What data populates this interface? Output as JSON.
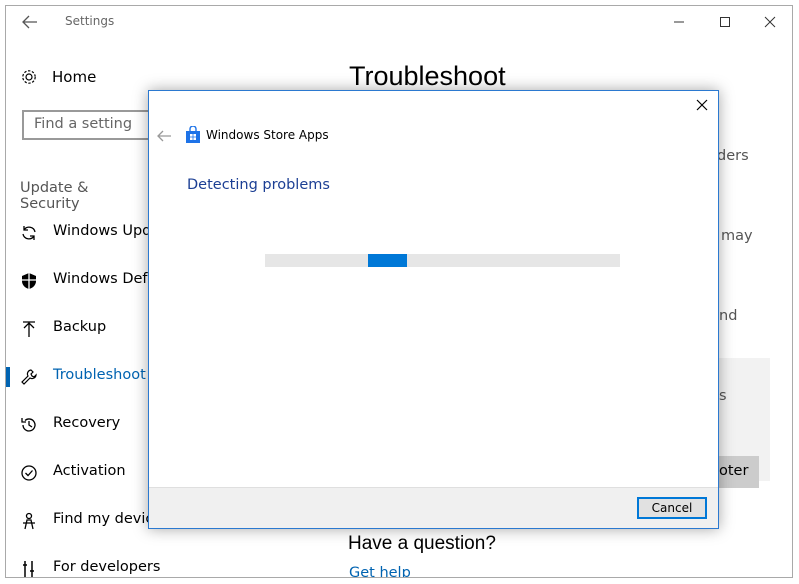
{
  "window": {
    "title": "Settings",
    "controls": [
      "minimize",
      "maximize",
      "close"
    ]
  },
  "sidebar": {
    "home_label": "Home",
    "search_placeholder": "Find a setting",
    "section": "Update & Security",
    "items": [
      {
        "label": "Windows Update",
        "icon": "sync-icon",
        "active": false
      },
      {
        "label": "Windows Defender",
        "icon": "shield-icon",
        "active": false
      },
      {
        "label": "Backup",
        "icon": "backup-arrow-icon",
        "active": false
      },
      {
        "label": "Troubleshoot",
        "icon": "wrench-icon",
        "active": true
      },
      {
        "label": "Recovery",
        "icon": "history-icon",
        "active": false
      },
      {
        "label": "Activation",
        "icon": "checkmark-circle-icon",
        "active": false
      },
      {
        "label": "Find my device",
        "icon": "person-locate-icon",
        "active": false
      },
      {
        "label": "For developers",
        "icon": "developer-tools-icon",
        "active": false
      }
    ]
  },
  "main": {
    "title": "Troubleshoot",
    "peek_fragments": [
      "ders",
      "may",
      "nd",
      "s"
    ],
    "button_fragment": "oter",
    "question_heading": "Have a question?",
    "help_link": "Get help"
  },
  "dialog": {
    "app_title": "Windows Store Apps",
    "status": "Detecting problems",
    "progress": {
      "indeterminate": true,
      "segment_start_fraction": 0.29,
      "segment_width_fraction": 0.11
    },
    "cancel_label": "Cancel"
  },
  "colors": {
    "accent": "#0063b1",
    "progress": "#0078d7",
    "dialog_border": "#2b79d0",
    "status_text": "#1c3f94"
  }
}
